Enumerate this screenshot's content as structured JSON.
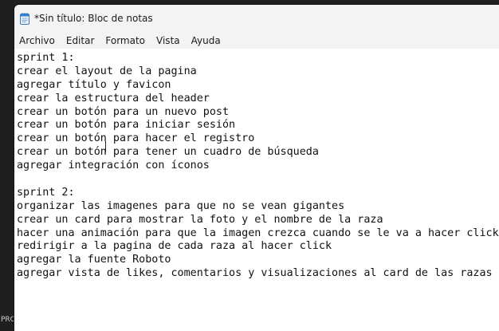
{
  "window": {
    "title": "*Sin título: Bloc de notas",
    "icon": "notepad-icon"
  },
  "menu": {
    "items": [
      "Archivo",
      "Editar",
      "Formato",
      "Vista",
      "Ayuda"
    ]
  },
  "editor": {
    "lines": [
      "sprint 1:",
      "crear el layout de la pagina",
      "agregar título y favicon",
      "crear la estructura del header",
      "crear un botón para un nuevo post",
      "crear un botón para iniciar sesión",
      "crear un botón para hacer el registro",
      "crear un botón para tener un cuadro de búsqueda",
      "agregar integración con íconos",
      "",
      "sprint 2:",
      "organizar las imagenes para que no se vean gigantes",
      "crear un card para mostrar la foto y el nombre de la raza",
      "hacer una animación para que la imagen crezca cuando se le va a hacer click",
      "redirigir a la pagina de cada raza al hacer click",
      "agregar la fuente Roboto",
      "agregar vista de likes, comentarios y visualizaciones al card de las razas"
    ]
  },
  "desktop": {
    "partial_text": "PRO"
  }
}
